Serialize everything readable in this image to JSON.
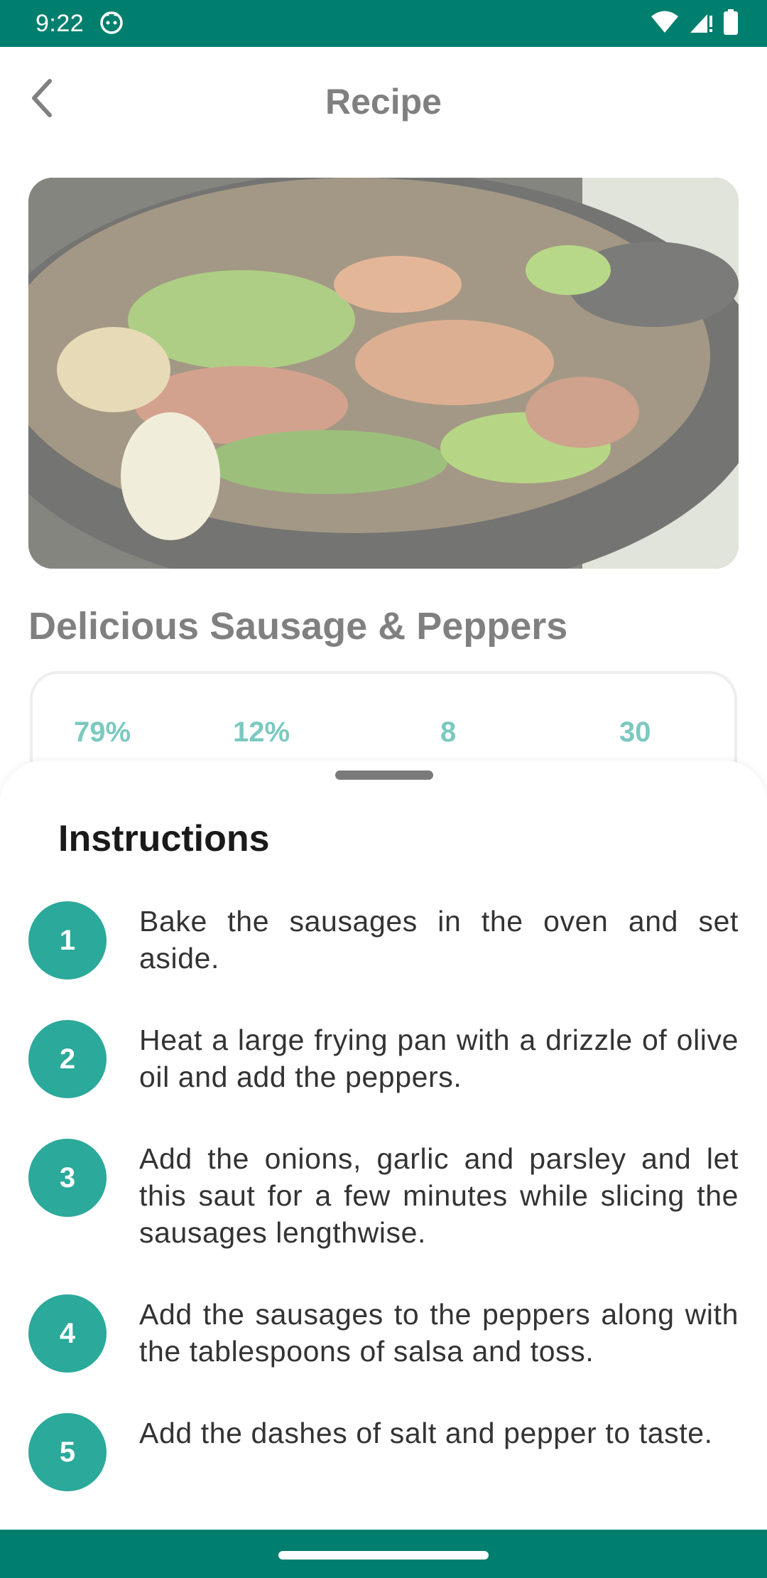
{
  "status_bar": {
    "time": "9:22",
    "icons": [
      "notification-cat-icon",
      "wifi-icon",
      "signal-icon",
      "battery-icon"
    ],
    "color": "#007F6E"
  },
  "app_bar": {
    "title": "Recipe",
    "back_icon": "chevron-left-icon"
  },
  "recipe": {
    "title": "Delicious Sausage & Peppers",
    "image_alt": "Sausage and peppers in cast iron skillet",
    "stats": [
      {
        "value": "79%"
      },
      {
        "value": "12%"
      },
      {
        "value": "8"
      },
      {
        "value": "30"
      }
    ]
  },
  "instructions": {
    "title": "Instructions",
    "steps": [
      {
        "number": "1",
        "text": "Bake the sausages in the oven and set aside."
      },
      {
        "number": "2",
        "text": "Heat a large frying pan with a drizzle of olive oil and add the peppers."
      },
      {
        "number": "3",
        "text": "Add the onions, garlic and parsley and let this saut for a few minutes while slicing the sausages lengthwise."
      },
      {
        "number": "4",
        "text": "Add the sausages to the peppers along with the tablespoons of salsa and toss."
      },
      {
        "number": "5",
        "text": "Add the dashes of salt and pepper to taste."
      }
    ]
  },
  "colors": {
    "accent": "#2BA99A",
    "primary_dark": "#007F6E"
  }
}
